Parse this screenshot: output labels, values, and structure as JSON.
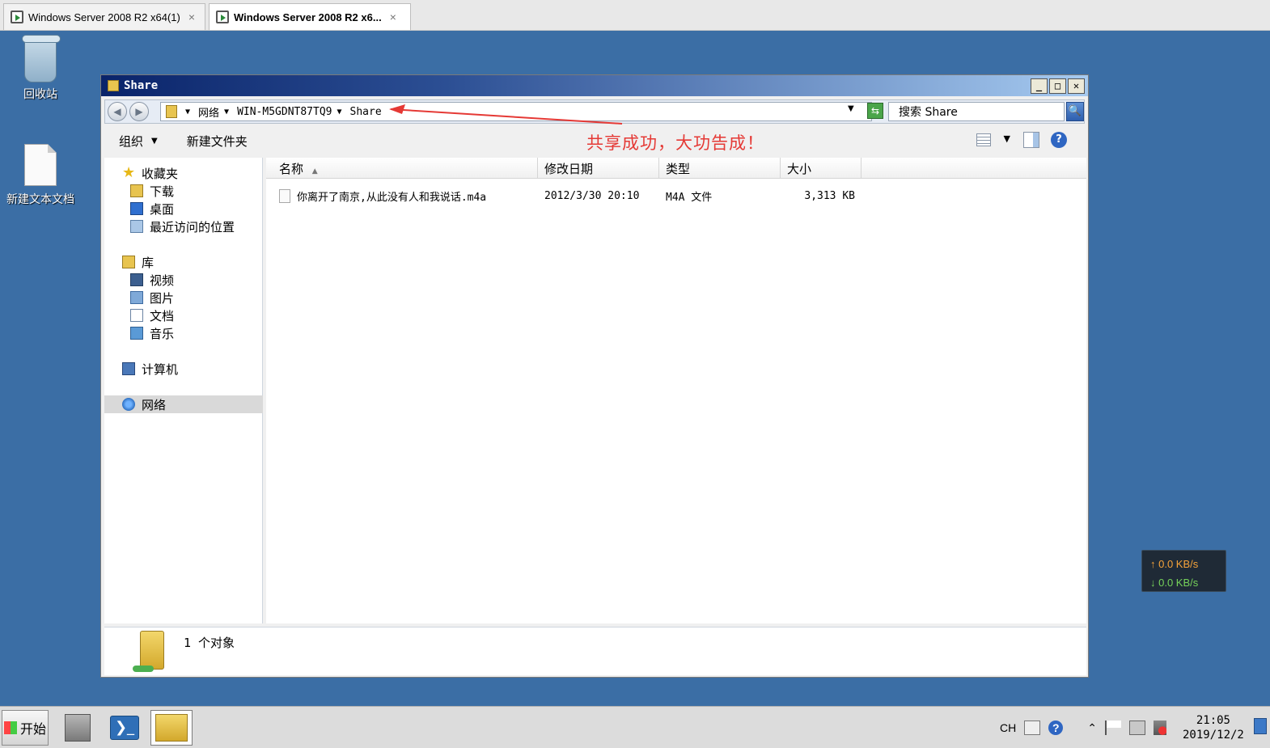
{
  "vm_tabs": [
    {
      "label": "Windows Server 2008 R2 x64(1)",
      "close": "×"
    },
    {
      "label": "Windows Server 2008 R2 x6...",
      "close": "×"
    }
  ],
  "desktop": {
    "icons": [
      {
        "label": "回收站"
      },
      {
        "label": "新建文本文档"
      }
    ]
  },
  "window": {
    "title": "Share",
    "controls": {
      "minimize": "_",
      "maximize": "□",
      "close": "✕"
    },
    "nav": {
      "back": "◀",
      "forward": "▶"
    },
    "address": {
      "crumbs": [
        "网络",
        "WIN-M5GDNT87TQ9",
        "Share"
      ],
      "drop": "▼",
      "refresh": "⇆"
    },
    "search": {
      "placeholder": "搜索 Share",
      "button": "🔍"
    },
    "commands": {
      "organize": "组织",
      "organize_drop": "▼",
      "new_folder": "新建文件夹",
      "view_drop": "▼",
      "help": "?"
    },
    "annotation": "共享成功，大功告成！",
    "nav_pane": {
      "favorites": "收藏夹",
      "downloads": "下载",
      "desktop": "桌面",
      "recent": "最近访问的位置",
      "libraries": "库",
      "videos": "视频",
      "pictures": "图片",
      "documents": "文档",
      "music": "音乐",
      "computer": "计算机",
      "network": "网络"
    },
    "columns": {
      "name": "名称",
      "modified": "修改日期",
      "type": "类型",
      "size": "大小",
      "sort": "▲"
    },
    "files": [
      {
        "name": "你离开了南京,从此没有人和我说话.m4a",
        "modified": "2012/3/30 20:10",
        "type": "M4A 文件",
        "size": "3,313 KB"
      }
    ],
    "status": {
      "count": "1 个对象"
    }
  },
  "speed_widget": {
    "up": "↑ 0.0 KB/s",
    "down": "↓ 0.0 KB/s",
    "up_color": "#f6a33a",
    "down_color": "#76d25a"
  },
  "taskbar": {
    "start": "开始",
    "powershell_glyph": "❯_",
    "tray": {
      "lang": "CH",
      "chevron": "⌃",
      "help": "?"
    },
    "clock": {
      "time": "21:05",
      "date": "2019/12/2"
    }
  },
  "colors": {
    "desktop": "#3b6ea5",
    "annotation": "#e53935",
    "title_gradient_start": "#0a246a"
  }
}
